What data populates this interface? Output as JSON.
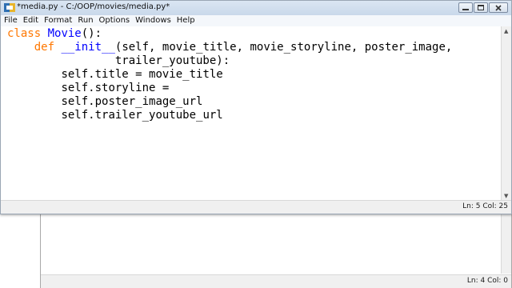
{
  "window": {
    "title": "*media.py - C:/OOP/movies/media.py*",
    "status": "Ln: 5 Col: 25"
  },
  "menu": [
    "File",
    "Edit",
    "Format",
    "Run",
    "Options",
    "Windows",
    "Help"
  ],
  "code": {
    "line1_kw": "class",
    "line1_name": "Movie",
    "line1_rest": "():",
    "line2_kw": "def",
    "line2_name": "__init__",
    "line2_rest": "(self, movie_title, movie_storyline, poster_image,",
    "line3": "trailer_youtube):",
    "line4": "self.title = movie_title",
    "line5": "self.storyline =",
    "line6": "self.poster_image_url",
    "line7": "self.trailer_youtube_url"
  },
  "background_window": {
    "status": "Ln: 4 Col: 0"
  },
  "colors": {
    "keyword": "#ff7700",
    "definition": "#0000ff"
  }
}
